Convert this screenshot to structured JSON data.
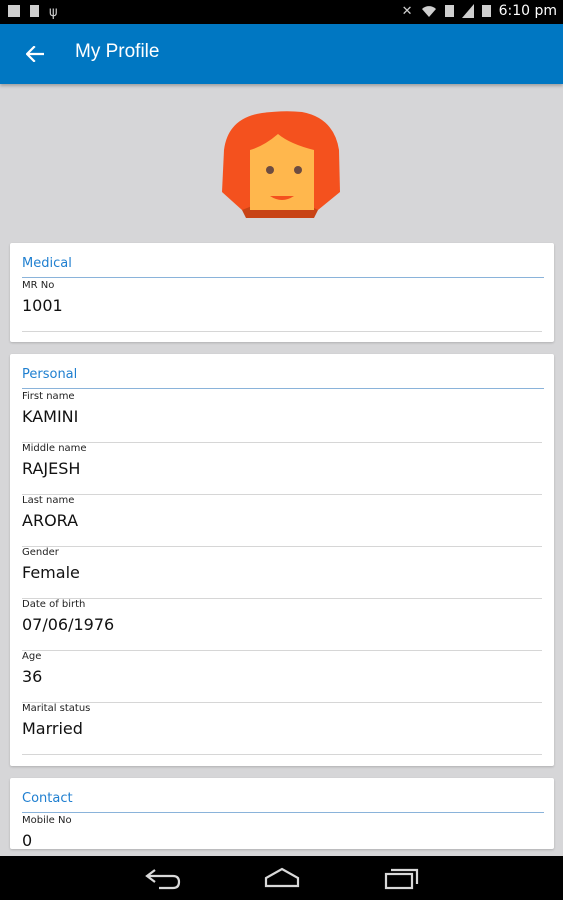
{
  "status_bar": {
    "time": "6:10 pm",
    "left_icons": [
      "screenshot-icon",
      "sd-card-icon",
      "usb-icon"
    ],
    "right_icons": [
      "bluetooth-off-icon",
      "wifi-icon",
      "sim-icon",
      "signal-icon",
      "battery-icon"
    ]
  },
  "app_bar": {
    "title": "My Profile",
    "back_icon": "arrow-left-icon",
    "color": "#0077c2"
  },
  "avatar": {
    "icon": "female-avatar-icon",
    "hair_color": "#f4511e",
    "face_color": "#ffb74d"
  },
  "sections": {
    "medical": {
      "header": "Medical",
      "fields": [
        {
          "label": "MR No",
          "value": "1001"
        }
      ]
    },
    "personal": {
      "header": "Personal",
      "fields": [
        {
          "label": "First name",
          "value": "KAMINI"
        },
        {
          "label": "Middle name",
          "value": "RAJESH"
        },
        {
          "label": "Last name",
          "value": "ARORA"
        },
        {
          "label": "Gender",
          "value": "Female"
        },
        {
          "label": "Date of birth",
          "value": "07/06/1976"
        },
        {
          "label": "Age",
          "value": "36"
        },
        {
          "label": "Marital status",
          "value": "Married"
        }
      ]
    },
    "contact": {
      "header": "Contact",
      "fields": [
        {
          "label": "Mobile No",
          "value": "0"
        }
      ]
    }
  },
  "nav_bar": {
    "icons": [
      "back-nav-icon",
      "home-nav-icon",
      "recents-nav-icon"
    ]
  }
}
